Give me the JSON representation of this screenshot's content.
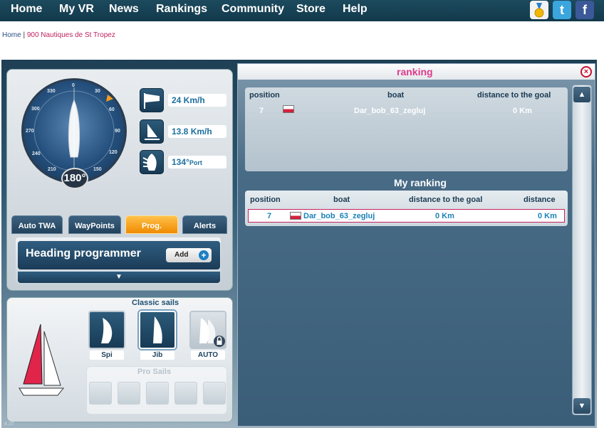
{
  "nav": {
    "items": [
      "Home",
      "My VR",
      "News",
      "Rankings",
      "Community",
      "Store",
      "Help"
    ],
    "social_twitter": "t",
    "social_facebook": "f"
  },
  "breadcrumb": {
    "home": "Home",
    "separator": " | ",
    "race": "900 Nautiques de St Tropez"
  },
  "compass": {
    "ticks": [
      "0",
      "30",
      "60",
      "90",
      "120",
      "150",
      "210",
      "240",
      "270",
      "300",
      "330"
    ],
    "heading": "180°"
  },
  "instruments": {
    "wind_speed": "24 Km/h",
    "boat_speed": "13.8 Km/h",
    "twa_value": "134°",
    "twa_side": "Port"
  },
  "tabs": {
    "auto_twa": "Auto TWA",
    "waypoints": "WayPoints",
    "prog": "Prog.",
    "alerts": "Alerts"
  },
  "programmer": {
    "title": "Heading programmer",
    "add": "Add",
    "plus": "+",
    "expand": "▼"
  },
  "sails": {
    "title": "Classic sails",
    "spi": "Spi",
    "jib": "Jib",
    "auto": "AUTO",
    "pro_title": "Pro Sails"
  },
  "version": "4.20",
  "ranking": {
    "title": "ranking",
    "close": "×",
    "columns": {
      "position": "position",
      "boat": "boat",
      "distance_goal": "distance to the goal",
      "distance": "distance"
    },
    "row": {
      "position": "7",
      "boat": "Dar_bob_63_zegluj",
      "distance_goal": "0 Km"
    },
    "my_title": "My ranking",
    "my_row": {
      "position": "7",
      "boat": "Dar_bob_63_zegluj",
      "distance_goal": "0 Km",
      "distance": "0 Km"
    },
    "scroll_up": "▲",
    "scroll_down": "▼"
  },
  "colors": {
    "nav_bg": "#12394b",
    "accent_pink": "#e0398a",
    "active_tab": "#f08a00",
    "link_blue": "#1b82b8"
  }
}
